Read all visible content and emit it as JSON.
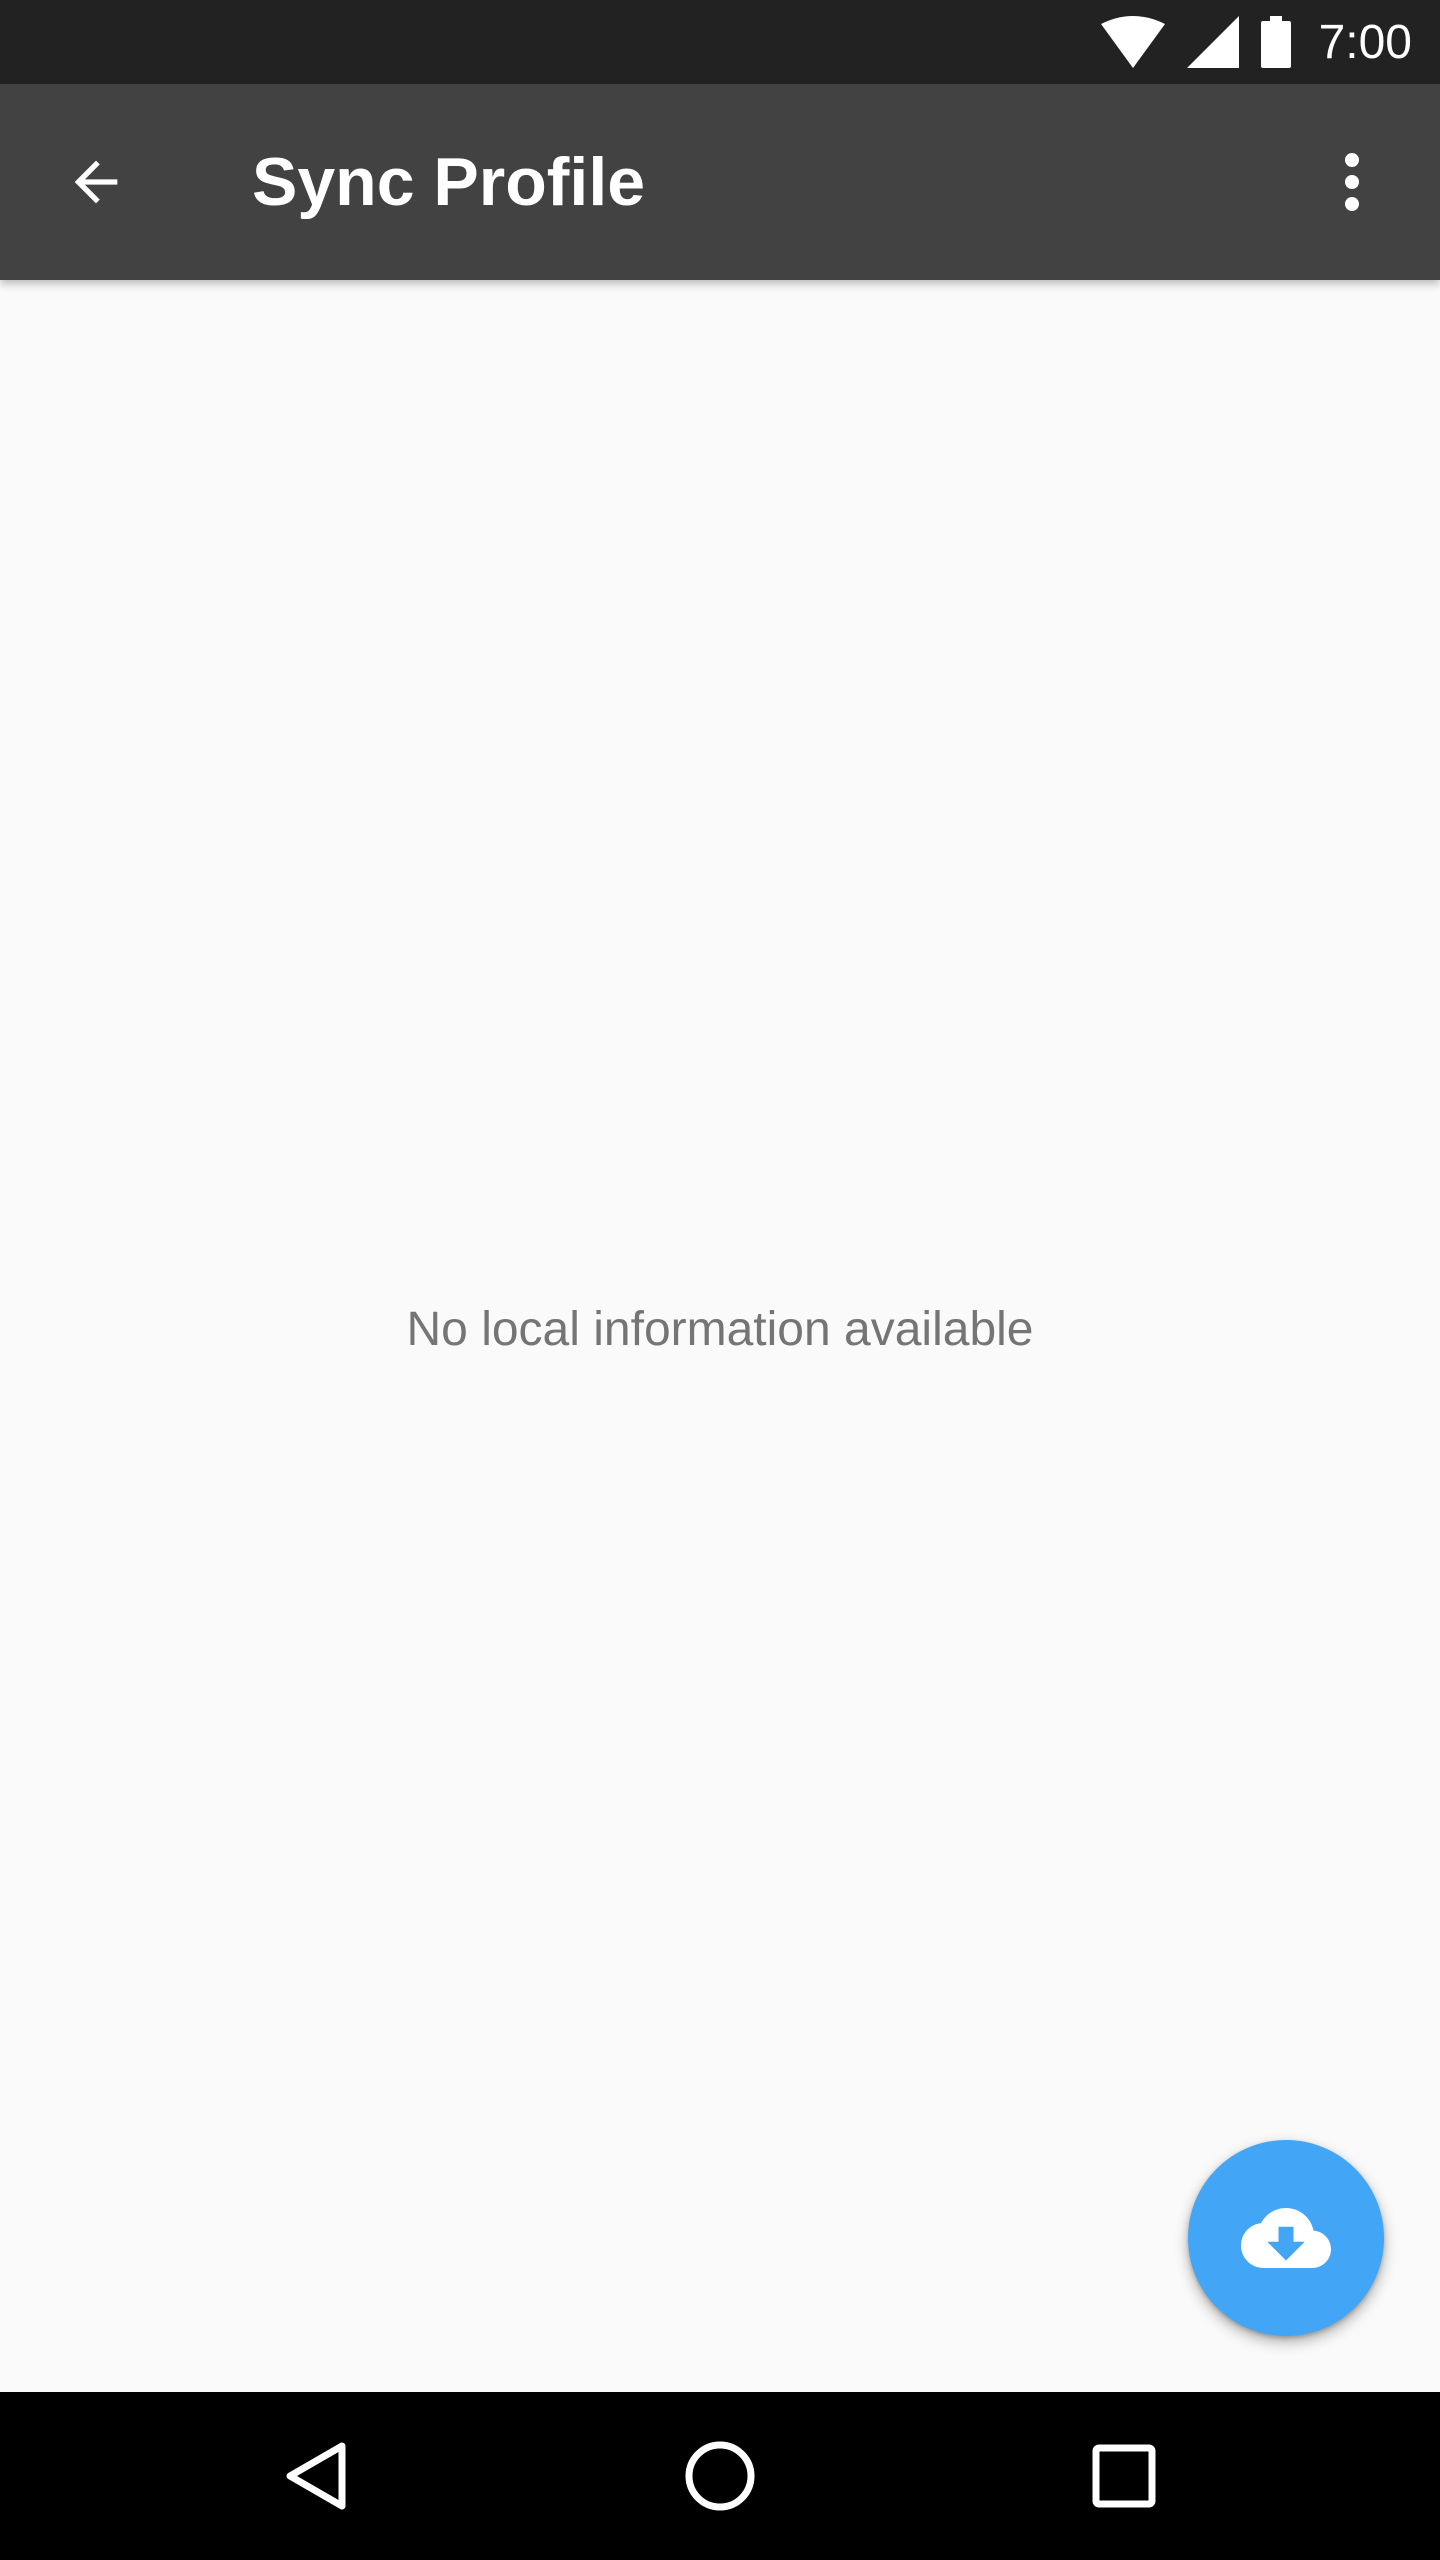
{
  "status_bar": {
    "time": "7:00",
    "icons": [
      "wifi-icon",
      "cell-signal-icon",
      "battery-icon"
    ]
  },
  "app_bar": {
    "title": "Sync Profile",
    "back_icon": "arrow-back-icon",
    "overflow_icon": "more-vert-icon"
  },
  "content": {
    "empty_message": "No local information available"
  },
  "fab": {
    "icon": "cloud-download-icon",
    "color": "#42a5f5"
  },
  "nav_bar": {
    "icons": [
      "nav-back-icon",
      "nav-home-icon",
      "nav-recents-icon"
    ]
  },
  "colors": {
    "status_bar": "#222222",
    "app_bar": "#424242",
    "background": "#fafafa",
    "text_secondary": "#757575"
  }
}
